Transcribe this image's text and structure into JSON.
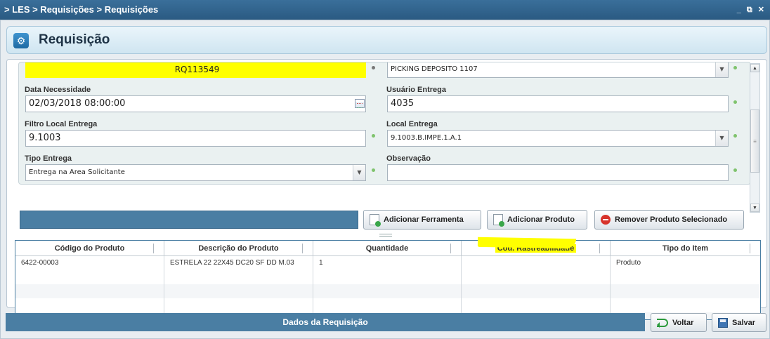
{
  "window": {
    "breadcrumb": "> LES > Requisições > Requisições",
    "controls": [
      "_",
      "⧉",
      "✕"
    ]
  },
  "header": {
    "title": "Requisição",
    "icon": "gear-icon"
  },
  "form": {
    "requisicao_value": "RQ113549",
    "deposito_value": "PICKING DEPOSITO 1107",
    "data_necessidade": {
      "label": "Data Necessidade",
      "value": "02/03/2018 08:00:00"
    },
    "usuario_entrega": {
      "label": "Usuário Entrega",
      "value": "4035"
    },
    "filtro_local_entrega": {
      "label": "Filtro Local Entrega",
      "value": "9.1003"
    },
    "local_entrega": {
      "label": "Local Entrega",
      "value": "9.1003.B.IMPE.1.A.1"
    },
    "tipo_entrega": {
      "label": "Tipo Entrega",
      "value": "Entrega na Area Solicitante"
    },
    "observacao": {
      "label": "Observação",
      "value": ""
    }
  },
  "actions": {
    "add_tool": "Adicionar Ferramenta",
    "add_product": "Adicionar Produto",
    "remove_product": "Remover Produto Selecionado"
  },
  "grid": {
    "columns": [
      "Código do Produto",
      "Descrição do Produto",
      "Quantidade",
      "Cód. Rastreabilidade",
      "Tipo do Item"
    ],
    "rows": [
      [
        "6422-00003",
        "ESTRELA 22 22X45 DC20 SF DD M.03",
        "1",
        "",
        "Produto"
      ]
    ]
  },
  "footer": {
    "title": "Dados da Requisição",
    "back": "Voltar",
    "save": "Salvar"
  }
}
